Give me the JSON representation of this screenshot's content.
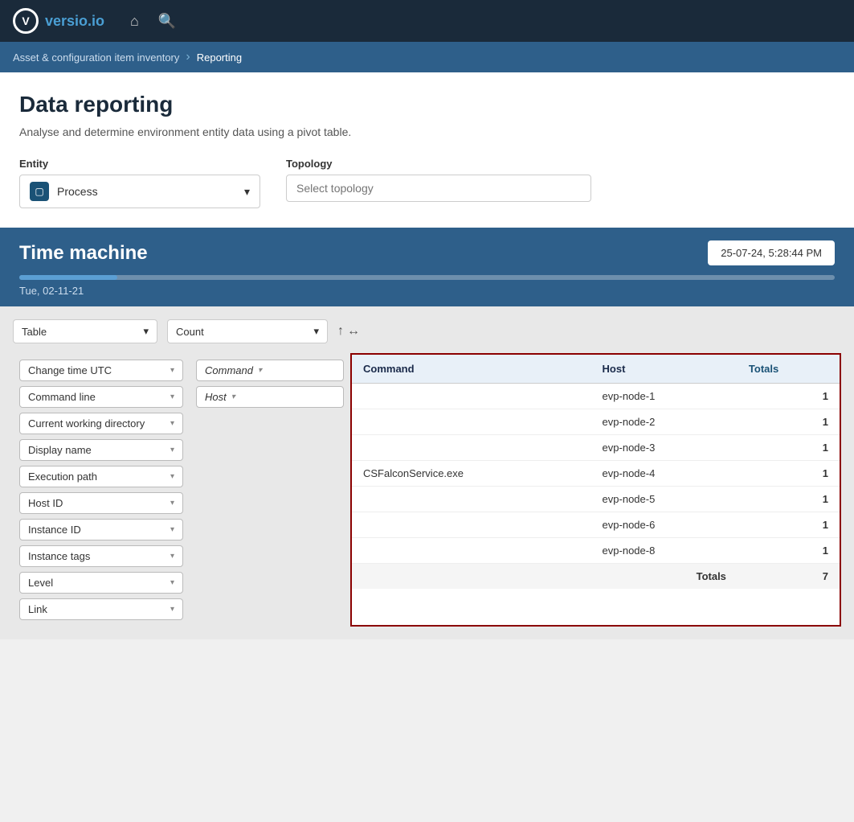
{
  "app": {
    "logo_letter": "V",
    "logo_name": "versio",
    "logo_suffix": ".io"
  },
  "breadcrumb": {
    "parent": "Asset & configuration item inventory",
    "current": "Reporting"
  },
  "page": {
    "title": "Data reporting",
    "description": "Analyse and determine environment entity data using a pivot table."
  },
  "entity_label": "Entity",
  "entity_value": "Process",
  "topology_label": "Topology",
  "topology_placeholder": "Select topology",
  "time_machine": {
    "title": "Time machine",
    "current_date": "25-07-24, 5:28:44 PM",
    "slider_date": "Tue, 02-11-21"
  },
  "table_type": "Table",
  "count_type": "Count",
  "fields": [
    {
      "label": "Change time UTC"
    },
    {
      "label": "Command line"
    },
    {
      "label": "Current working directory"
    },
    {
      "label": "Display name"
    },
    {
      "label": "Execution path"
    },
    {
      "label": "Host ID"
    },
    {
      "label": "Instance ID"
    },
    {
      "label": "Instance tags"
    },
    {
      "label": "Level"
    },
    {
      "label": "Link"
    }
  ],
  "pivot_rows": [
    {
      "label": "Command"
    },
    {
      "label": "Host"
    }
  ],
  "table": {
    "headers": [
      "Command",
      "Host",
      "Totals"
    ],
    "rows": [
      {
        "command": "",
        "host": "evp-node-1",
        "count": "1"
      },
      {
        "command": "",
        "host": "evp-node-2",
        "count": "1"
      },
      {
        "command": "",
        "host": "evp-node-3",
        "count": "1"
      },
      {
        "command": "CSFalconService.exe",
        "host": "evp-node-4",
        "count": "1"
      },
      {
        "command": "",
        "host": "evp-node-5",
        "count": "1"
      },
      {
        "command": "",
        "host": "evp-node-6",
        "count": "1"
      },
      {
        "command": "",
        "host": "evp-node-8",
        "count": "1"
      }
    ],
    "totals_label": "Totals",
    "totals_value": "7"
  },
  "sort_up": "↑",
  "sort_lr": "↔",
  "dropdown_arrow": "▾"
}
